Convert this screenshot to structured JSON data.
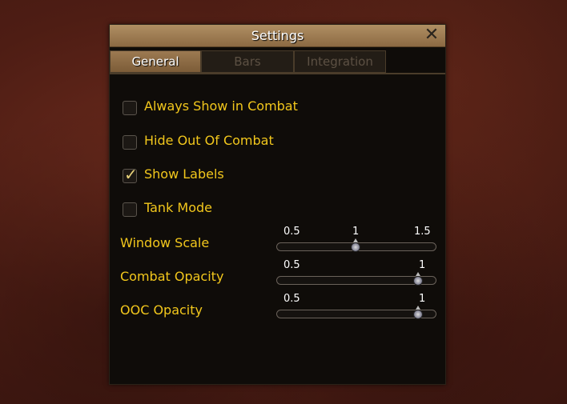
{
  "window": {
    "title": "Settings"
  },
  "tabs": [
    {
      "label": "General",
      "active": true
    },
    {
      "label": "Bars",
      "active": false
    },
    {
      "label": "Integration",
      "active": false
    }
  ],
  "options": [
    {
      "label": "Always Show in Combat",
      "checked": false
    },
    {
      "label": "Hide Out Of Combat",
      "checked": false
    },
    {
      "label": "Show Labels",
      "checked": true
    },
    {
      "label": "Tank Mode",
      "checked": false
    }
  ],
  "sliders": [
    {
      "label": "Window Scale",
      "min_label": "0.5",
      "mid_label": "1",
      "max_label": "1.5",
      "value": 1,
      "min": 0.5,
      "max": 1.5
    },
    {
      "label": "Combat Opacity",
      "min_label": "0.5",
      "max_label": "1",
      "value": 1,
      "min": 0.5,
      "max": 1
    },
    {
      "label": "OOC Opacity",
      "min_label": "0.5",
      "max_label": "1",
      "value": 1,
      "min": 0.5,
      "max": 1
    }
  ],
  "colors": {
    "label": "#f2c71c",
    "titlebar": "#9c7a52",
    "panel": "#0f0c09"
  }
}
